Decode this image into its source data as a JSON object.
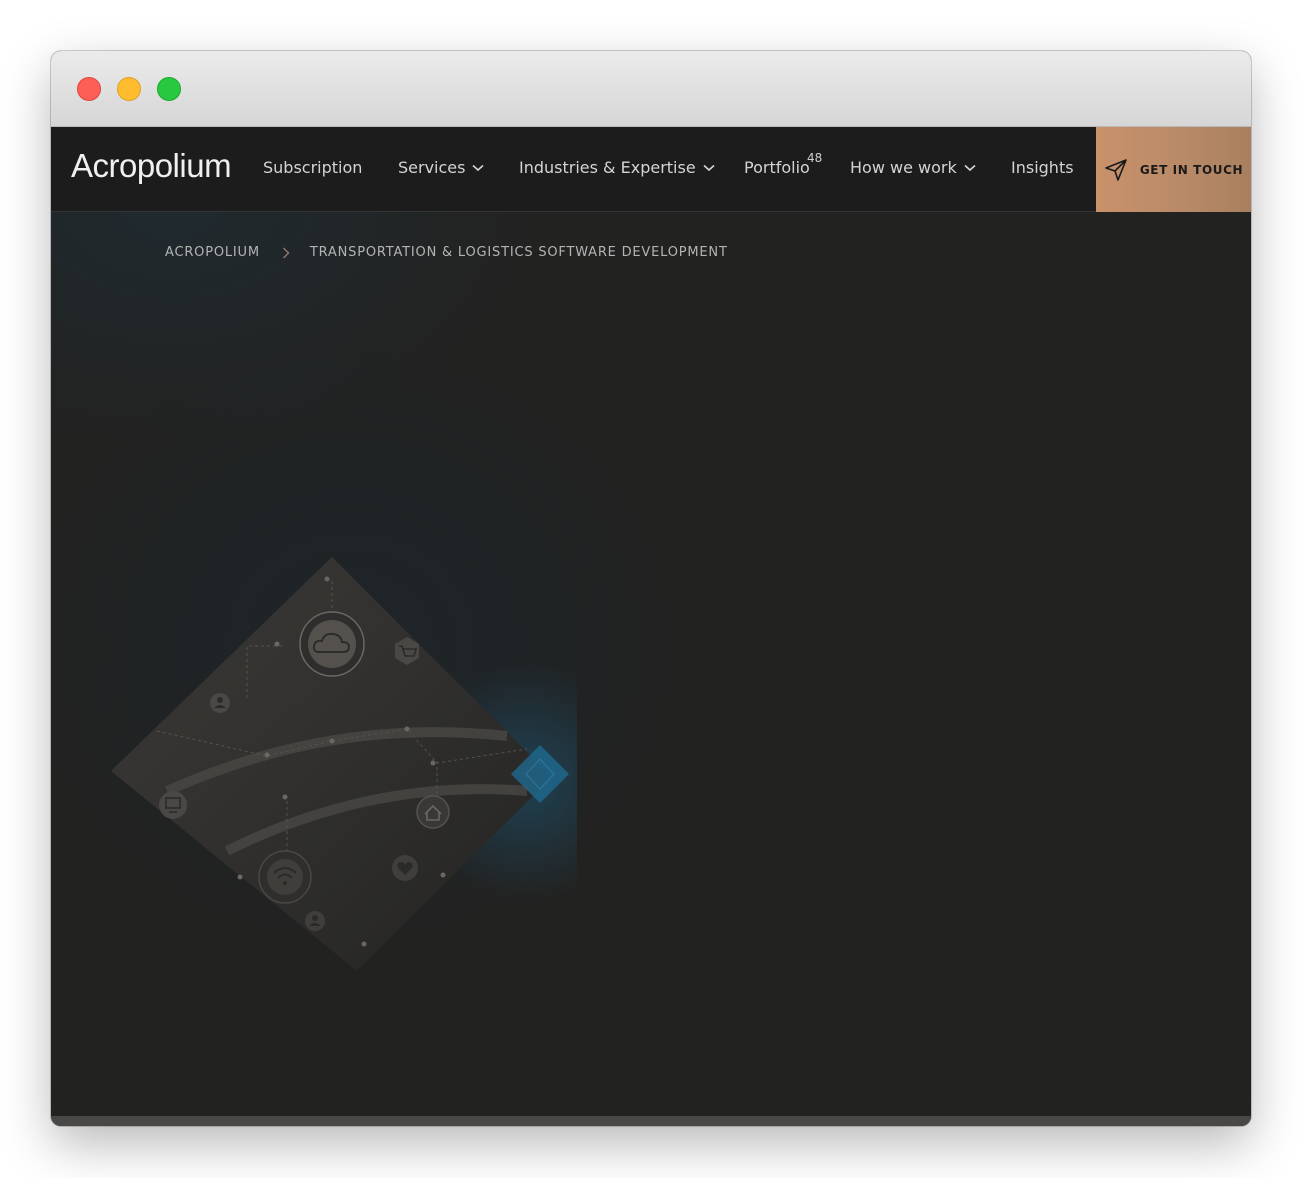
{
  "brand": {
    "logo_text": "Acropolium"
  },
  "nav": {
    "items": [
      {
        "label": "Subscription",
        "has_dropdown": false
      },
      {
        "label": "Services",
        "has_dropdown": true
      },
      {
        "label": "Industries & Expertise",
        "has_dropdown": true
      },
      {
        "label": "Portfolio",
        "has_dropdown": false,
        "badge": "48"
      },
      {
        "label": "How we work",
        "has_dropdown": true
      },
      {
        "label": "Insights",
        "has_dropdown": false
      }
    ],
    "cta_label": "GET IN TOUCH"
  },
  "breadcrumb": {
    "home": "ACROPOLIUM",
    "current": "TRANSPORTATION & LOGISTICS SOFTWARE DEVELOPMENT"
  },
  "hero_icons": [
    "cloud-icon",
    "cart-icon",
    "user-icon",
    "monitor-icon",
    "home-icon",
    "wifi-icon",
    "heart-icon",
    "user-icon",
    "accent-diamond"
  ],
  "colors": {
    "nav_bg": "#1c1c1c",
    "page_bg": "#222221",
    "cta_bg": "#c8926a",
    "accent_blue": "#1f6e95",
    "text_light": "#d4d4d4"
  }
}
